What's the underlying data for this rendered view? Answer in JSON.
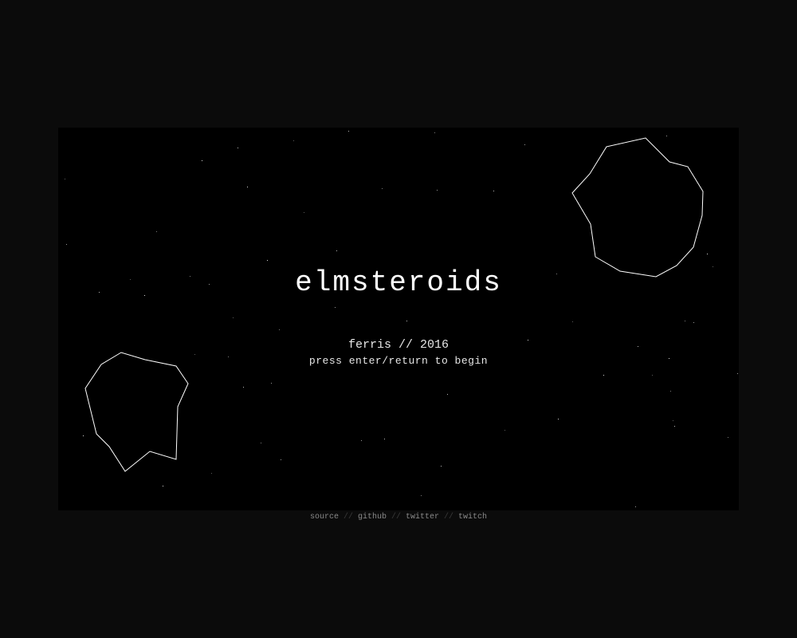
{
  "game": {
    "title": "elmsteroids",
    "credit": "ferris // 2016",
    "prompt": "press enter/return to begin"
  },
  "footer": {
    "links": [
      {
        "label": "source"
      },
      {
        "label": "github"
      },
      {
        "label": "twitter"
      },
      {
        "label": "twitch"
      }
    ],
    "separator": "//"
  },
  "colors": {
    "page_background": "#0b0b0b",
    "canvas_background": "#000000",
    "asteroid_stroke": "#ffffff",
    "star": "#ffffff",
    "link": "#8a8a8a",
    "separator": "#3a3a3a"
  }
}
